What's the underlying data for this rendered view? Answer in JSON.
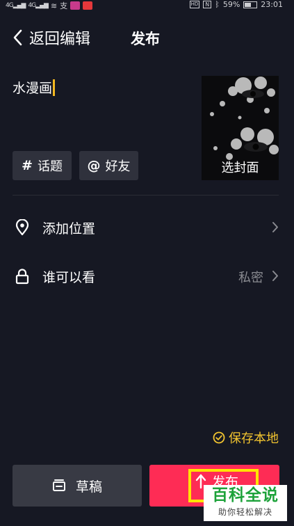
{
  "status_bar": {
    "network_left_1": "4G",
    "network_left_2": "4G",
    "pay_icon_label": "支",
    "hd_label": "HD",
    "nfc_label": "N",
    "bluetooth_icon": "bluetooth-icon",
    "battery_percent": "59%",
    "battery_level": 0.59,
    "time": "23:01"
  },
  "header": {
    "back_label": "返回编辑",
    "title": "发布"
  },
  "description": {
    "value": "水漫画"
  },
  "cover": {
    "label": "选封面"
  },
  "chips": {
    "topic_glyph": "#",
    "topic_label": "话题",
    "friends_glyph": "@",
    "friends_label": "好友"
  },
  "rows": {
    "location_label": "添加位置",
    "visibility_label": "谁可以看",
    "visibility_value": "私密"
  },
  "save_local": {
    "label": "保存本地",
    "checked": true
  },
  "buttons": {
    "draft_label": "草稿",
    "publish_label": "发布"
  },
  "watermark": {
    "title": "百科全说",
    "subtitle": "助你轻松解决"
  },
  "colors": {
    "background": "#161823",
    "accent": "#fe2c55",
    "gold": "#f2c42f",
    "highlight": "#ffe400"
  }
}
